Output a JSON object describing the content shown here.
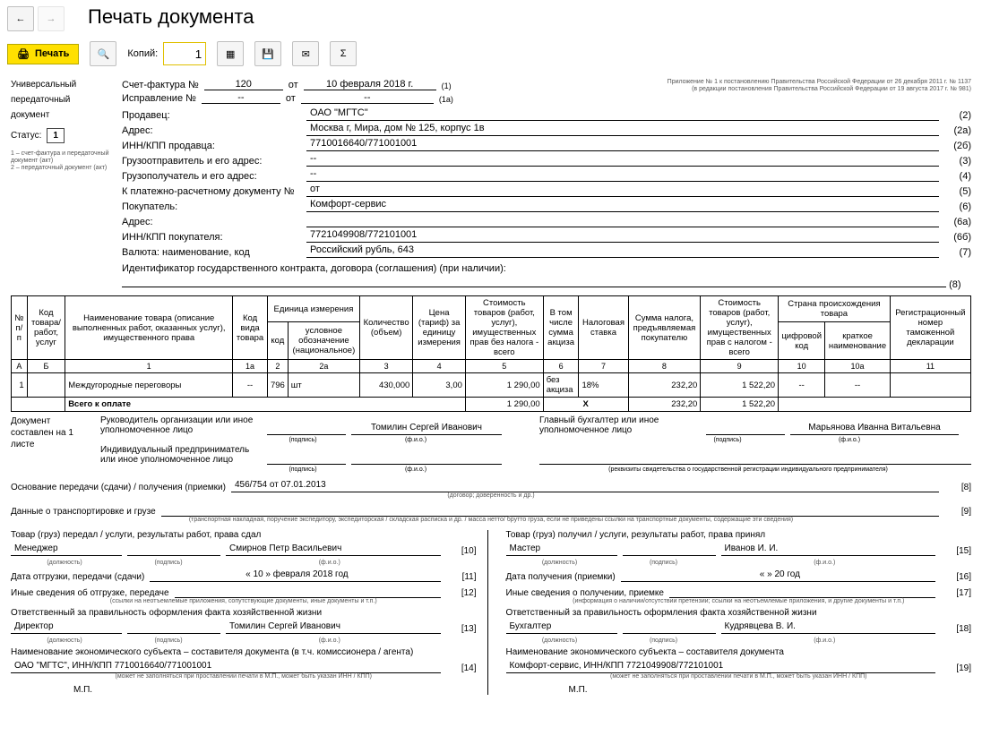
{
  "page_title": "Печать документа",
  "toolbar": {
    "print": "Печать",
    "copies_label": "Копий:",
    "copies_value": "1"
  },
  "left": {
    "titles": [
      "Универсальный",
      "передаточный",
      "документ"
    ],
    "status_label": "Статус:",
    "status_value": "1",
    "legend": "1 – счет-фактура и передаточный документ (акт)\n2 – передаточный документ (акт)"
  },
  "header": {
    "schet_label": "Счет-фактура №",
    "schet_no": "120",
    "ot_label": "от",
    "schet_date": "10 февраля 2018 г.",
    "schet_n": "(1)",
    "ispr_label": "Исправление №",
    "ispr_no": "--",
    "ispr_date": "--",
    "ispr_n": "(1a)",
    "appendix1": "Приложение № 1 к постановлению Правительства Российской Федерации от 26 декабря 2011 г. № 1137",
    "appendix2": "(в редакции постановления Правительства Российской Федерации от 19 августа 2017 г. № 981)"
  },
  "info": [
    {
      "label": "Продавец:",
      "value": "ОАО \"МГТС\"",
      "p": "(2)"
    },
    {
      "label": "Адрес:",
      "value": "Москва г, Мира, дом № 125, корпус 1в",
      "p": "(2а)"
    },
    {
      "label": "ИНН/КПП продавца:",
      "value": "7710016640/771001001",
      "p": "(2б)"
    },
    {
      "label": "Грузоотправитель и его адрес:",
      "value": "--",
      "p": "(3)"
    },
    {
      "label": "Грузополучатель и его адрес:",
      "value": "--",
      "p": "(4)"
    },
    {
      "label": "К платежно-расчетному документу №",
      "value": "от",
      "p": "(5)"
    },
    {
      "label": "Покупатель:",
      "value": "Комфорт-сервис",
      "p": "(6)"
    },
    {
      "label": "Адрес:",
      "value": "",
      "p": "(6а)"
    },
    {
      "label": "ИНН/КПП покупателя:",
      "value": "7721049908/772101001",
      "p": "(6б)"
    },
    {
      "label": "Валюта: наименование, код",
      "value": "Российский рубль, 643",
      "p": "(7)"
    }
  ],
  "gov_id": {
    "label": "Идентификатор государственного контракта, договора (соглашения) (при наличии):",
    "p": "(8)"
  },
  "cols": {
    "c0": "№ п/п",
    "c1": "Код товара/ работ, услуг",
    "c2": "Наименование товара (описание выполненных работ, оказанных услуг), имущественного права",
    "c3": "Код вида товара",
    "c4_group": "Единица измерения",
    "c4a": "код",
    "c4b": "условное обозначение (национальное)",
    "c5": "Количество (объем)",
    "c6": "Цена (тариф) за единицу измерения",
    "c7": "Стоимость товаров (работ, услуг), имущественных прав без налога - всего",
    "c8": "В том числе сумма акциза",
    "c9": "Налоговая ставка",
    "c10": "Сумма налога, предъявляемая покупателю",
    "c11": "Стоимость товаров (работ, услуг), имущественных прав с налогом - всего",
    "c12_group": "Страна происхождения товара",
    "c12a": "цифровой код",
    "c12b": "краткое наименование",
    "c13": "Регистрационный номер таможенной декларации"
  },
  "numline": [
    "А",
    "Б",
    "1",
    "1а",
    "2",
    "2а",
    "3",
    "4",
    "5",
    "6",
    "7",
    "8",
    "9",
    "10",
    "10а",
    "11"
  ],
  "rows": [
    {
      "n": "1",
      "code": "",
      "name": "Междугородные переговоры",
      "kind": "--",
      "ucode": "796",
      "uname": "шт",
      "qty": "430,000",
      "price": "3,00",
      "sum_no_tax": "1 290,00",
      "excise": "без акциза",
      "rate": "18%",
      "tax": "232,20",
      "sum_with_tax": "1 522,20",
      "country_code": "--",
      "country_name": "--",
      "decl": ""
    }
  ],
  "total": {
    "label": "Всего к оплате",
    "sum_no_tax": "1 290,00",
    "x": "X",
    "tax": "232,20",
    "sum_with_tax": "1 522,20"
  },
  "sig": {
    "sheet": "Документ составлен на 1 листе",
    "role_head": "Руководитель организации или иное уполномоченное лицо",
    "head_name": "Томилин Сергей Иванович",
    "role_chief": "Главный бухгалтер или иное уполномоченное лицо",
    "chief_name": "Марьянова Иванна Витальевна",
    "ip_label": "Индивидуальный предприниматель или иное уполномоченное лицо",
    "podpis": "(подпись)",
    "fio": "(ф.и.о.)",
    "rekv": "(реквизиты свидетельства о государственной регистрации индивидуального предпринимателя)"
  },
  "transfer": {
    "basis_label": "Основание передачи (сдачи) / получения (приемки)",
    "basis_value": "456/754 от 07.01.2013",
    "basis_hint": "(договор; доверенность и др.)",
    "p8": "[8]",
    "transport_label": "Данные о транспортировке и грузе",
    "transport_hint": "(транспортная накладная, поручение экспедитору, экспедиторская / складская расписка и др. / масса нетто/ брутто груза, если не приведены ссылки на транспортные документы, содержащие эти сведения)",
    "p9": "[9]"
  },
  "foot": {
    "left": {
      "goods_passed": "Товар (груз) передал / услуги, результаты работ, права сдал",
      "role": "Менеджер",
      "role_hint": "(должность)",
      "name": "Смирнов Петр Васильевич",
      "p10": "[10]",
      "ship_date_label": "Дата отгрузки, передачи (сдачи)",
      "ship_date": "« 10 »   февраля   2018   год",
      "p11": "[11]",
      "other_label": "Иные сведения об отгрузке, передаче",
      "other_hint": "(ссылки на неотъемлемые приложения, сопутствующие документы, иные документы и т.п.)",
      "p12": "[12]",
      "resp_label": "Ответственный за правильность оформления факта хозяйственной жизни",
      "resp_role": "Директор",
      "resp_name": "Томилин Сергей Иванович",
      "p13": "[13]",
      "econ_label": "Наименование экономического субъекта – составителя документа (в т.ч. комиссионера / агента)",
      "econ_value": "ОАО \"МГТС\", ИНН/КПП 7710016640/771001001",
      "p14": "[14]",
      "econ_hint": "(может не заполняться при проставлении печати в М.П., может быть указан ИНН / КПП)",
      "mp": "М.П."
    },
    "right": {
      "goods_recv": "Товар (груз) получил / услуги, результаты работ, права принял",
      "role": "Мастер",
      "name": "Иванов И. И.",
      "p15": "[15]",
      "recv_date_label": "Дата получения (приемки)",
      "recv_date": "«        »                 20     год",
      "p16": "[16]",
      "other_label": "Иные сведения о получении, приемке",
      "other_hint": "(информация о наличии/отсутствии претензии; ссылки на неотъемлемые приложения, и другие документы и т.п.)",
      "p17": "[17]",
      "resp_label": "Ответственный за правильность оформления факта хозяйственной жизни",
      "resp_role": "Бухгалтер",
      "resp_name": "Кудрявцева В. И.",
      "p18": "[18]",
      "econ_label": "Наименование экономического субъекта – составителя документа",
      "econ_value": "Комфорт-сервис, ИНН/КПП 7721049908/772101001",
      "p19": "[19]",
      "econ_hint": "(может не заполняться при проставлении печати в М.П., может быть указан ИНН / КПП)",
      "mp": "М.П."
    }
  }
}
